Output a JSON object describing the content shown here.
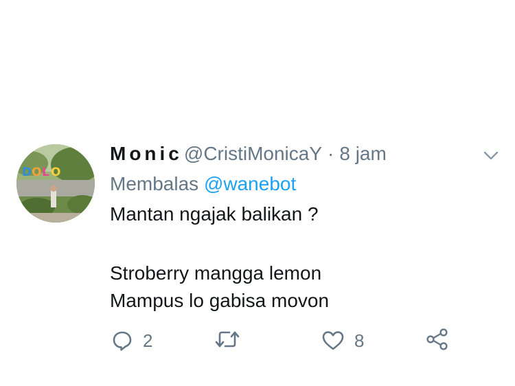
{
  "tweet": {
    "display_name": "Monic",
    "handle": "@CristiMonicaY",
    "separator": "·",
    "time": "8 jam",
    "reply_label": "Membalas",
    "reply_handle": "@wanebot",
    "text_lines": [
      "Mantan ngajak balikan ?",
      "Stroberry mangga lemon",
      "Mampus lo gabisa movon"
    ],
    "avatar_sign_letters": [
      "D",
      "O",
      "L",
      "O"
    ]
  },
  "actions": {
    "reply_icon": "reply-icon",
    "reply_count": "2",
    "retweet_icon": "retweet-icon",
    "like_icon": "heart-icon",
    "like_count": "8",
    "share_icon": "share-icon"
  },
  "colors": {
    "text": "#14171a",
    "secondary": "#657786",
    "link": "#1da1f2"
  }
}
